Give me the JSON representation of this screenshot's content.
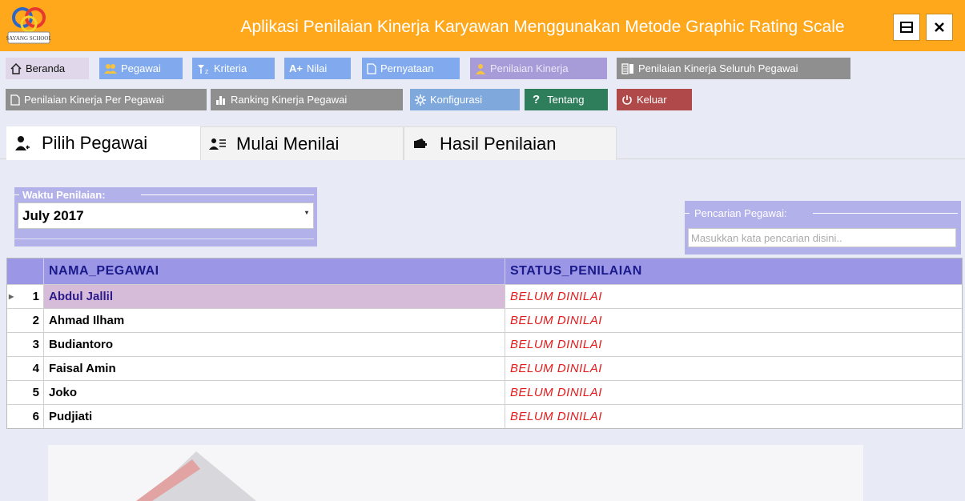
{
  "window": {
    "logo_text": "SAYANG SCHOOL",
    "title": "Aplikasi Penilaian Kinerja Karyawan Menggunakan Metode Graphic Rating Scale",
    "accent_color": "#ffa81c"
  },
  "menu": {
    "row1": [
      {
        "label": "Beranda",
        "icon": "home-icon",
        "color": "#e0d8ea"
      },
      {
        "label": "Pegawai",
        "icon": "users-icon",
        "color": "#80a9ee"
      },
      {
        "label": "Kriteria",
        "icon": "sort-icon",
        "color": "#80a9ee"
      },
      {
        "label": "Nilai",
        "icon": "grade-icon",
        "color": "#80a9ee"
      },
      {
        "label": "Pernyataan",
        "icon": "document-icon",
        "color": "#80a9ee"
      },
      {
        "label": "Penilaian Kinerja",
        "icon": "user-icon",
        "color": "#a89cd8"
      },
      {
        "label": "Penilaian Kinerja Seluruh Pegawai",
        "icon": "report-icon",
        "color": "#8f8f8f"
      }
    ],
    "row2": [
      {
        "label": "Penilaian Kinerja Per Pegawai",
        "icon": "document-icon",
        "color": "#8f8f8f"
      },
      {
        "label": "Ranking Kinerja Pegawai",
        "icon": "ranking-icon",
        "color": "#8f8f8f"
      },
      {
        "label": "Konfigurasi",
        "icon": "gear-icon",
        "color": "#7fa9dd"
      },
      {
        "label": "Tentang",
        "icon": "question-icon",
        "color": "#2e7d5b"
      },
      {
        "label": "Keluar",
        "icon": "power-icon",
        "color": "#b04a4a"
      }
    ]
  },
  "tabs": [
    {
      "label": "Pilih Pegawai",
      "icon": "user-select-icon",
      "active": true
    },
    {
      "label": "Mulai Menilai",
      "icon": "user-list-icon",
      "active": false
    },
    {
      "label": "Hasil Penilaian",
      "icon": "wallet-icon",
      "active": false
    }
  ],
  "filter": {
    "legend": "Waktu Penilaian:",
    "selected": "July 2017"
  },
  "search": {
    "legend": "Pencarian Pegawai:",
    "placeholder": "Masukkan kata pencarian disini..",
    "value": ""
  },
  "table": {
    "columns": [
      "NAMA_PEGAWAI",
      "STATUS_PENILAIAN"
    ],
    "rows": [
      {
        "no": "1",
        "name": "Abdul Jallil",
        "status": "BELUM DINILAI"
      },
      {
        "no": "2",
        "name": "Ahmad Ilham",
        "status": "BELUM DINILAI"
      },
      {
        "no": "3",
        "name": "Budiantoro",
        "status": "BELUM DINILAI"
      },
      {
        "no": "4",
        "name": "Faisal Amin",
        "status": "BELUM DINILAI"
      },
      {
        "no": "5",
        "name": "Joko",
        "status": "BELUM DINILAI"
      },
      {
        "no": "6",
        "name": "Pudjiati",
        "status": "BELUM DINILAI"
      }
    ]
  }
}
